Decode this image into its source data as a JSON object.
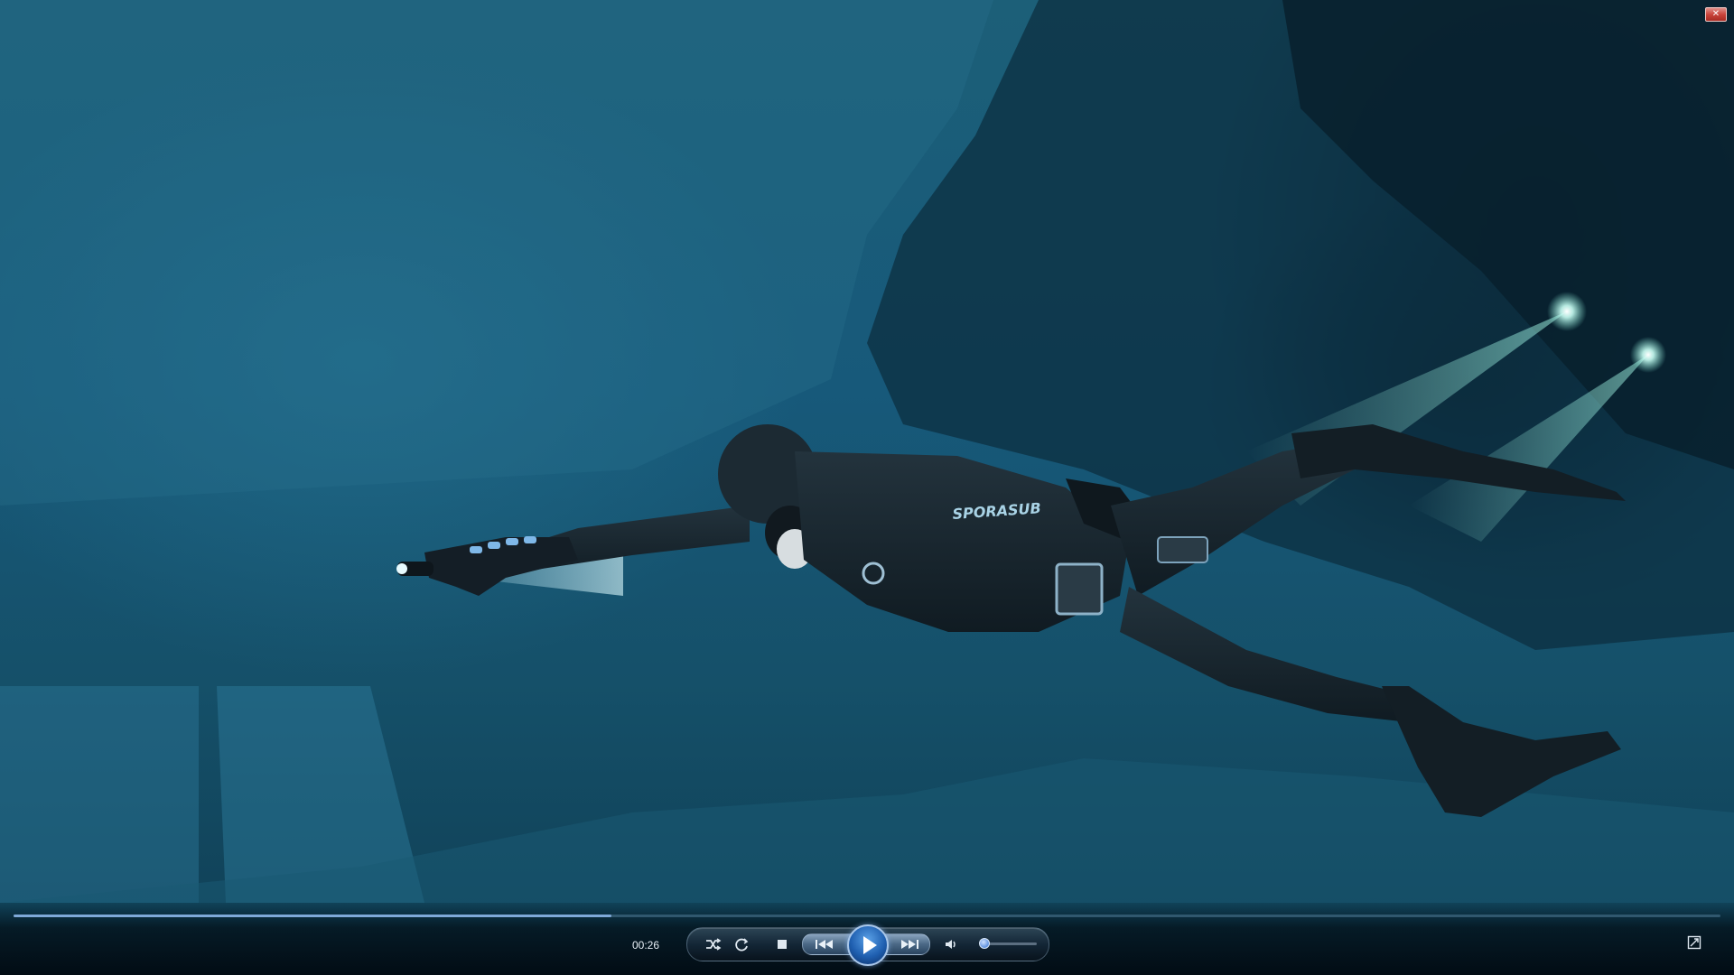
{
  "player": {
    "elapsed_time": "00:26",
    "seek_progress": 0.35,
    "volume_level": 0.05
  },
  "video": {
    "wetsuit_brand_text": "SPORASUB"
  },
  "icons": {
    "shuffle": "shuffle-icon",
    "repeat": "repeat-icon",
    "stop": "stop-icon",
    "previous": "previous-icon",
    "play": "play-icon",
    "next": "next-icon",
    "mute": "speaker-icon",
    "fullscreen": "fullscreen-icon",
    "close": "close-icon"
  },
  "colors": {
    "seek_fill": "#7fa9d8",
    "play_button": "#1f5fb0",
    "close_button": "#c9453c"
  }
}
